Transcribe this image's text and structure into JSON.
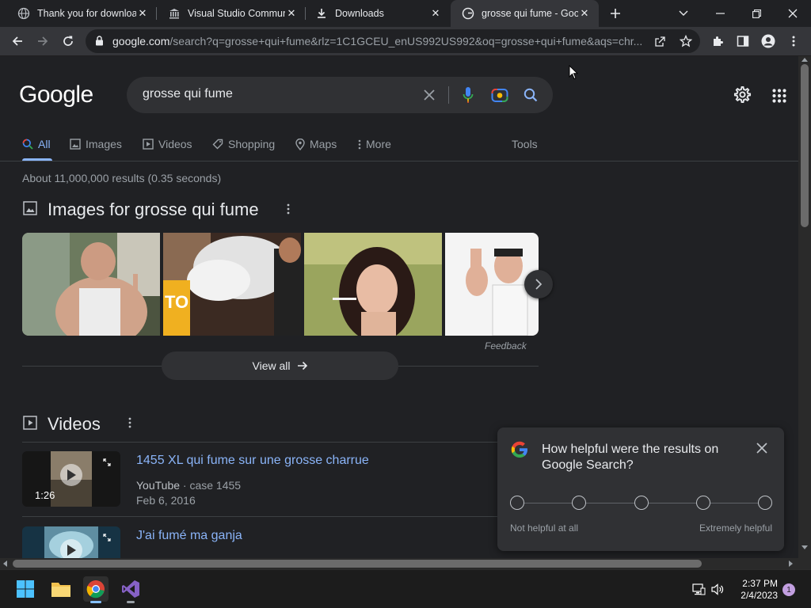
{
  "browser": {
    "tabs": [
      {
        "title": "Thank you for downloa",
        "icon": "globe-icon"
      },
      {
        "title": "Visual Studio Communi",
        "icon": "building-icon"
      },
      {
        "title": "Downloads",
        "icon": "download-icon"
      },
      {
        "title": "grosse qui fume - Goo",
        "icon": "google-g-icon",
        "active": true
      }
    ],
    "url_host": "google.com",
    "url_rest": "/search?q=grosse+qui+fume&rlz=1C1GCEU_enUS992US992&oq=grosse+qui+fume&aqs=chr..."
  },
  "google": {
    "logo": "Google",
    "query": "grosse qui fume",
    "nav": [
      {
        "label": "All",
        "icon": "search-icon"
      },
      {
        "label": "Images",
        "icon": "image-icon"
      },
      {
        "label": "Videos",
        "icon": "video-icon"
      },
      {
        "label": "Shopping",
        "icon": "tag-icon"
      },
      {
        "label": "Maps",
        "icon": "map-pin-icon"
      },
      {
        "label": "More",
        "icon": "more-vert-icon"
      }
    ],
    "tools": "Tools",
    "stats": "About 11,000,000 results (0.35 seconds)",
    "images_title": "Images for grosse qui fume",
    "feedback": "Feedback",
    "view_all": "View all",
    "videos_title": "Videos",
    "videos": [
      {
        "title": "1455 XL qui fume sur une grosse charrue",
        "source": "YouTube",
        "channel": "case 1455",
        "date": "Feb 6, 2016",
        "duration": "1:26"
      },
      {
        "title": "J'ai fumé ma ganja"
      }
    ]
  },
  "survey": {
    "question": "How helpful were the results on Google Search?",
    "low_label": "Not helpful at all",
    "high_label": "Extremely helpful",
    "options": 5
  },
  "taskbar": {
    "time": "2:37 PM",
    "date": "2/4/2023",
    "notifications": "1"
  }
}
